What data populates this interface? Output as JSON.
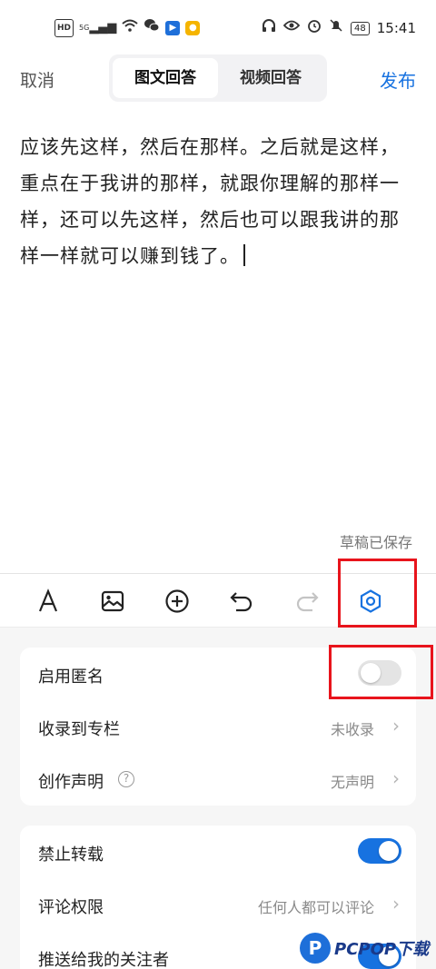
{
  "status_bar": {
    "left_icons": [
      "hd-icon",
      "signal-icon",
      "wifi-icon",
      "wechat-icon",
      "app-blue-icon",
      "app-yellow-icon"
    ],
    "hd": "HD",
    "signal": "5G",
    "battery": "48",
    "time": "15:41"
  },
  "header": {
    "cancel_label": "取消",
    "publish_label": "发布",
    "tabs": [
      {
        "label": "图文回答",
        "active": true
      },
      {
        "label": "视频回答",
        "active": false
      }
    ]
  },
  "editor": {
    "content": "应该先这样，然后在那样。之后就是这样，重点在于我讲的那样，就跟你理解的那样一样，还可以先这样，然后也可以跟我讲的那样一样就可以赚到钱了。",
    "draft_status": "草稿已保存"
  },
  "toolbar": {
    "items": [
      "text-format-icon",
      "image-icon",
      "add-circle-icon",
      "undo-icon",
      "redo-icon",
      "settings-hex-icon"
    ],
    "accent_color": "#1772e0",
    "highlight_color": "#e8141c"
  },
  "settings": {
    "group1": {
      "anonymous": {
        "label": "启用匿名",
        "enabled": false
      },
      "column": {
        "label": "收录到专栏",
        "value": "未收录"
      },
      "declaration": {
        "label": "创作声明",
        "value": "无声明"
      }
    },
    "group2": {
      "no_repost": {
        "label": "禁止转载",
        "enabled": true
      },
      "comment_permission": {
        "label": "评论权限",
        "value": "任何人都可以评论"
      },
      "push_followers": {
        "label": "推送给我的关注者",
        "enabled": true
      }
    }
  },
  "watermark": {
    "logo": "P",
    "text": "PCPOP下载"
  }
}
